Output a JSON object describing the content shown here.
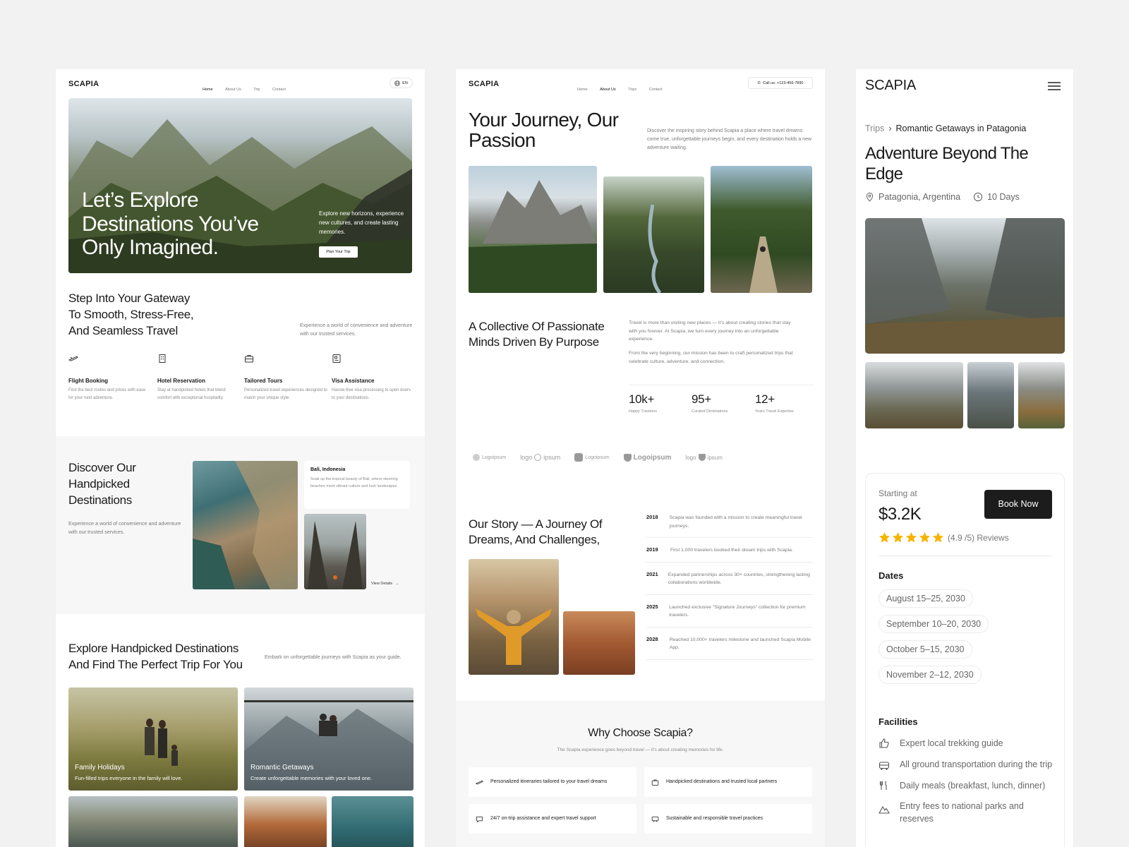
{
  "brand": "SCAPIA",
  "panel1": {
    "nav": [
      "Home",
      "About Us",
      "Trip",
      "Contact"
    ],
    "lang": "EN",
    "hero": {
      "title": "Let’s Explore Destinations You’ve Only Imagined.",
      "blurb": "Explore new horizons, experience new cultures, and create lasting memories.",
      "cta": "Plan Your Trip"
    },
    "gateway": {
      "title": "Step Into Your Gateway To Smooth, Stress-Free, And Seamless Travel",
      "desc": "Experience a world of convenience and adventure with our trusted services."
    },
    "services": [
      {
        "icon": "plane-icon",
        "title": "Flight Booking",
        "desc": "Find the best routes and prices with ease for your next adventure."
      },
      {
        "icon": "building-icon",
        "title": "Hotel Reservation",
        "desc": "Stay at handpicked hotels that blend comfort with exceptional hospitality."
      },
      {
        "icon": "briefcase-icon",
        "title": "Tailored Tours",
        "desc": "Personalized travel experiences designed to match your unique style."
      },
      {
        "icon": "passport-icon",
        "title": "Visa Assistance",
        "desc": "Hassle-free visa processing to open doors to your destinations."
      }
    ],
    "discover": {
      "title": "Discover Our Handpicked Destinations",
      "desc": "Experience a world of convenience and adventure with our trusted services.",
      "place_title": "Bali, Indonesia",
      "place_desc": "Soak up the tropical beauty of Bali, where stunning beaches meet vibrant culture and lush landscapes.",
      "view_details": "View Details"
    },
    "explore": {
      "title": "Explore Handpicked Destinations And Find The Perfect Trip For You",
      "desc": "Embark on unforgettable journeys with Scapia as your guide.",
      "cards": [
        {
          "title": "Family Holidays",
          "desc": "Fun-filled trips everyone in the family will love."
        },
        {
          "title": "Romantic Getaways",
          "desc": "Create unforgettable memories with your loved one."
        }
      ]
    }
  },
  "panel2": {
    "nav": [
      "Home",
      "About Us",
      "Trips",
      "Contact"
    ],
    "call": "Call us: +123-456-7890",
    "hero": {
      "title": "Your Journey, Our Passion",
      "desc": "Discover the inspiring story behind Scapia a place where travel dreams come true, unforgettable journeys begin, and every destination holds a new adventure waiting."
    },
    "collective": {
      "title": "A Collective Of Passionate Minds Driven By Purpose",
      "p1": "Travel is more than visiting new places — it’s about creating stories that stay with you forever. At Scapia, we turn every journey into an unforgettable experience.",
      "p2": "From the very beginning, our mission has been to craft personalized trips that celebrate culture, adventure, and connection."
    },
    "stats": [
      {
        "value": "10k+",
        "label": "Happy Travelers"
      },
      {
        "value": "95+",
        "label": "Curated Destinations"
      },
      {
        "value": "12+",
        "label": "Years Travel Expertise"
      }
    ],
    "logos": [
      "Logoipsum",
      "logo",
      "ipsum",
      "Logoipsum",
      "Logoipsum",
      "logo",
      "ipsum"
    ],
    "story": {
      "title": "Our Story — A Journey Of Dreams, And Challenges,",
      "timeline": [
        {
          "year": "2018",
          "text": "Scapia was founded with a mission to create meaningful travel journeys."
        },
        {
          "year": "2019",
          "text": "First 1,000 travelers booked their dream trips with Scapia."
        },
        {
          "year": "2021",
          "text": "Expanded partnerships across 30+ countries, strengthening lasting collaborations worldwide."
        },
        {
          "year": "2025",
          "text": "Launched exclusive \"Signature Journeys\" collection for premium travelers."
        },
        {
          "year": "2028",
          "text": "Reached 10,000+ travelers milestone and launched Scapia Mobile App."
        }
      ]
    },
    "why": {
      "title": "Why Choose Scapia?",
      "desc": "The Scapia experience goes beyond travel — it’s about creating memories for life.",
      "items": [
        {
          "icon": "plane-icon",
          "text": "Personalized itineraries tailored to your travel dreams"
        },
        {
          "icon": "briefcase-icon",
          "text": "Handpicked destinations and trusted local partners"
        },
        {
          "icon": "chat-icon",
          "text": "24/7 on-trip assistance and expert travel support"
        },
        {
          "icon": "bus-icon",
          "text": "Sustainable and responsible travel practices"
        }
      ]
    }
  },
  "panel3": {
    "breadcrumb": {
      "root": "Trips",
      "current": "Romantic Getaways in Patagonia"
    },
    "title": "Adventure Beyond The Edge",
    "location": "Patagonia, Argentina",
    "duration": "10 Days",
    "price_label": "Starting at",
    "price": "$3.2K",
    "book": "Book Now",
    "rating": 5,
    "rating_text": "(4.9 /5) Reviews",
    "dates_title": "Dates",
    "dates": [
      "August 15–25, 2030",
      "September 10–20, 2030",
      "October 5–15, 2030",
      "November 2–12, 2030"
    ],
    "facilities_title": "Facilities",
    "facilities": [
      {
        "icon": "thumbs-up-icon",
        "text": "Expert local trekking guide"
      },
      {
        "icon": "bus-icon",
        "text": "All ground transportation during the trip"
      },
      {
        "icon": "fork-knife-icon",
        "text": "Daily meals (breakfast, lunch, dinner)"
      },
      {
        "icon": "mountain-icon",
        "text": "Entry fees to national parks and reserves"
      }
    ]
  },
  "colors": {
    "accent": "#1c1c1c",
    "star": "#f5b400",
    "bg": "#f2f2f2"
  }
}
